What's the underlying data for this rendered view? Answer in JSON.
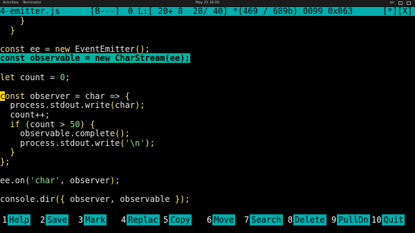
{
  "desktop_bar": {
    "activities": "Activities",
    "app_name": "Terminator",
    "datetime": "May 25  16:00",
    "indicators": [
      "en",
      "vol",
      "power"
    ]
  },
  "status_bar": {
    "filename": "4-emitter.js",
    "mode": "[B---]",
    "position": "0 L:[ 20+ 8  28/ 40] *(469 / 689b) 0099 0x063",
    "flags": "[*][X]"
  },
  "editor": {
    "lines": [
      {
        "parts": [
          {
            "t": "    }",
            "c": "punc"
          }
        ]
      },
      {
        "parts": [
          {
            "t": "  }",
            "c": "punc"
          }
        ]
      },
      {
        "parts": [
          {
            "t": "",
            "c": ""
          }
        ]
      },
      {
        "parts": [
          {
            "t": "const",
            "c": "kw"
          },
          {
            "t": " ee = ",
            "c": ""
          },
          {
            "t": "new",
            "c": "kw"
          },
          {
            "t": " EventEmitter",
            "c": ""
          },
          {
            "t": "();",
            "c": "punc"
          }
        ]
      },
      {
        "highlight": true,
        "parts": [
          {
            "t": "const observable = new CharStream(ee);",
            "c": "hl"
          }
        ]
      },
      {
        "parts": [
          {
            "t": "",
            "c": ""
          }
        ]
      },
      {
        "parts": [
          {
            "t": "let",
            "c": "kw"
          },
          {
            "t": " count = ",
            "c": ""
          },
          {
            "t": "0",
            "c": "num"
          },
          {
            "t": ";",
            "c": "punc"
          }
        ]
      },
      {
        "parts": [
          {
            "t": "",
            "c": ""
          }
        ]
      },
      {
        "parts": [
          {
            "t": "c",
            "c": "cursor"
          },
          {
            "t": "onst",
            "c": "kw"
          },
          {
            "t": " observer = char => ",
            "c": ""
          },
          {
            "t": "{",
            "c": "punc"
          }
        ]
      },
      {
        "parts": [
          {
            "t": "  process.stdout.write",
            "c": ""
          },
          {
            "t": "(",
            "c": "punc"
          },
          {
            "t": "char",
            "c": ""
          },
          {
            "t": ");",
            "c": "punc"
          }
        ]
      },
      {
        "parts": [
          {
            "t": "  count++",
            "c": ""
          },
          {
            "t": ";",
            "c": "punc"
          }
        ]
      },
      {
        "parts": [
          {
            "t": "  ",
            "c": ""
          },
          {
            "t": "if",
            "c": "kw"
          },
          {
            "t": " ",
            "c": ""
          },
          {
            "t": "(",
            "c": "punc"
          },
          {
            "t": "count > ",
            "c": ""
          },
          {
            "t": "50",
            "c": "num"
          },
          {
            "t": ") {",
            "c": "punc"
          }
        ]
      },
      {
        "parts": [
          {
            "t": "    observable.complete",
            "c": ""
          },
          {
            "t": "();",
            "c": "punc"
          }
        ]
      },
      {
        "parts": [
          {
            "t": "    process.stdout.write",
            "c": ""
          },
          {
            "t": "(",
            "c": "punc"
          },
          {
            "t": "'\\n'",
            "c": "str"
          },
          {
            "t": ");",
            "c": "punc"
          }
        ]
      },
      {
        "parts": [
          {
            "t": "  }",
            "c": "punc"
          }
        ]
      },
      {
        "parts": [
          {
            "t": "};",
            "c": "punc"
          }
        ]
      },
      {
        "parts": [
          {
            "t": "",
            "c": ""
          }
        ]
      },
      {
        "parts": [
          {
            "t": "ee.on",
            "c": ""
          },
          {
            "t": "(",
            "c": "punc"
          },
          {
            "t": "'char'",
            "c": "str"
          },
          {
            "t": ", observer",
            "c": ""
          },
          {
            "t": ");",
            "c": "punc"
          }
        ]
      },
      {
        "parts": [
          {
            "t": "",
            "c": ""
          }
        ]
      },
      {
        "parts": [
          {
            "t": "console.dir",
            "c": ""
          },
          {
            "t": "({",
            "c": "punc"
          },
          {
            "t": " observer, observable ",
            "c": ""
          },
          {
            "t": "});",
            "c": "punc"
          }
        ]
      }
    ]
  },
  "function_keys": [
    {
      "num": "1",
      "label": "Help"
    },
    {
      "num": "2",
      "label": "Save"
    },
    {
      "num": "3",
      "label": "Mark"
    },
    {
      "num": "4",
      "label": "Replac"
    },
    {
      "num": "5",
      "label": "Copy"
    },
    {
      "num": "6",
      "label": "Move"
    },
    {
      "num": "7",
      "label": "Search"
    },
    {
      "num": "8",
      "label": "Delete"
    },
    {
      "num": "9",
      "label": "PullDn"
    },
    {
      "num": "10",
      "label": "Quit"
    }
  ]
}
